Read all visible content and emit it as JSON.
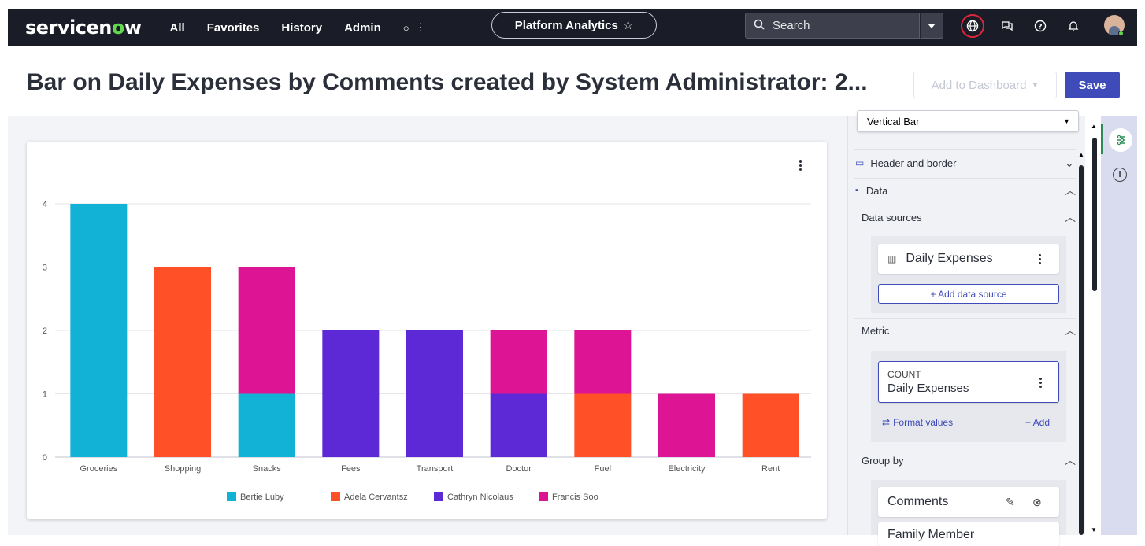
{
  "nav": {
    "logo_main": "servicen",
    "logo_o": "o",
    "logo_end": "w",
    "items": [
      "All",
      "Favorites",
      "History",
      "Admin"
    ],
    "app_pill": "Platform Analytics",
    "search_placeholder": "Search"
  },
  "page": {
    "title": "Bar on Daily Expenses by Comments created by System Administrator: 2...",
    "add_to_dashboard": "Add to Dashboard",
    "save": "Save"
  },
  "panel": {
    "viz_type": "Vertical Bar",
    "header_and_border": "Header and border",
    "data": "Data",
    "data_sources": "Data sources",
    "source_name": "Daily Expenses",
    "add_data_source": "+ Add data source",
    "metric": "Metric",
    "metric_agg": "COUNT",
    "metric_name": "Daily Expenses",
    "format_values": "Format values",
    "add": "+ Add",
    "group_by": "Group by",
    "group_1": "Comments",
    "group_2": "Family Member"
  },
  "colors": {
    "accent": "#3e4bb8",
    "nav_bg": "#1a1d27"
  },
  "chart_data": {
    "type": "bar",
    "stacked": true,
    "categories": [
      "Groceries",
      "Shopping",
      "Snacks",
      "Fees",
      "Transport",
      "Doctor",
      "Fuel",
      "Electricity",
      "Rent"
    ],
    "series": [
      {
        "name": "Bertie Luby",
        "color": "#12b2d6",
        "values": [
          4,
          0,
          1,
          0,
          0,
          0,
          0,
          0,
          0
        ]
      },
      {
        "name": "Adela Cervantsz",
        "color": "#ff5027",
        "values": [
          0,
          3,
          0,
          0,
          0,
          0,
          1,
          0,
          1
        ]
      },
      {
        "name": "Cathryn Nicolaus",
        "color": "#5d29d6",
        "values": [
          0,
          0,
          0,
          2,
          2,
          1,
          0,
          0,
          0
        ]
      },
      {
        "name": "Francis Soo",
        "color": "#dd1494",
        "values": [
          0,
          0,
          2,
          0,
          0,
          1,
          1,
          1,
          0
        ]
      }
    ],
    "yticks": [
      0,
      1,
      2,
      3,
      4
    ],
    "ylim": [
      0,
      4
    ],
    "grid": true,
    "legend": "bottom-center"
  }
}
